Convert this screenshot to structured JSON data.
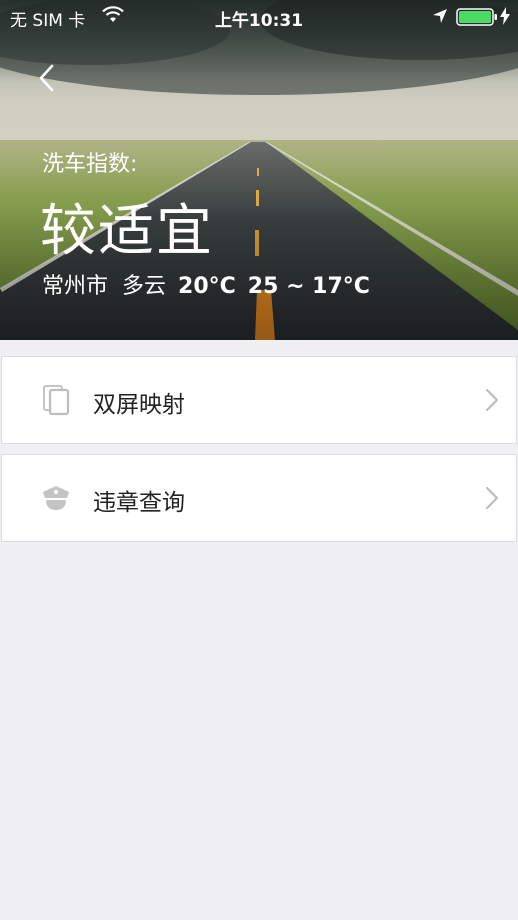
{
  "status_bar": {
    "carrier": "无 SIM 卡",
    "time": "上午10:31"
  },
  "hero": {
    "index_label": "洗车指数:",
    "index_value": "较适宜",
    "city": "常州市",
    "condition": "多云",
    "current_temp": "20°C",
    "temp_range": "25 ~ 17°C"
  },
  "menu": {
    "items": [
      {
        "label": "双屏映射",
        "icon": "dual-screen-icon"
      },
      {
        "label": "违章查询",
        "icon": "police-cap-icon"
      }
    ]
  },
  "colors": {
    "background": "#efeff4",
    "card": "#ffffff",
    "text": "#222222",
    "icon_gray": "#bdbdbd",
    "battery_green": "#4cd964"
  }
}
